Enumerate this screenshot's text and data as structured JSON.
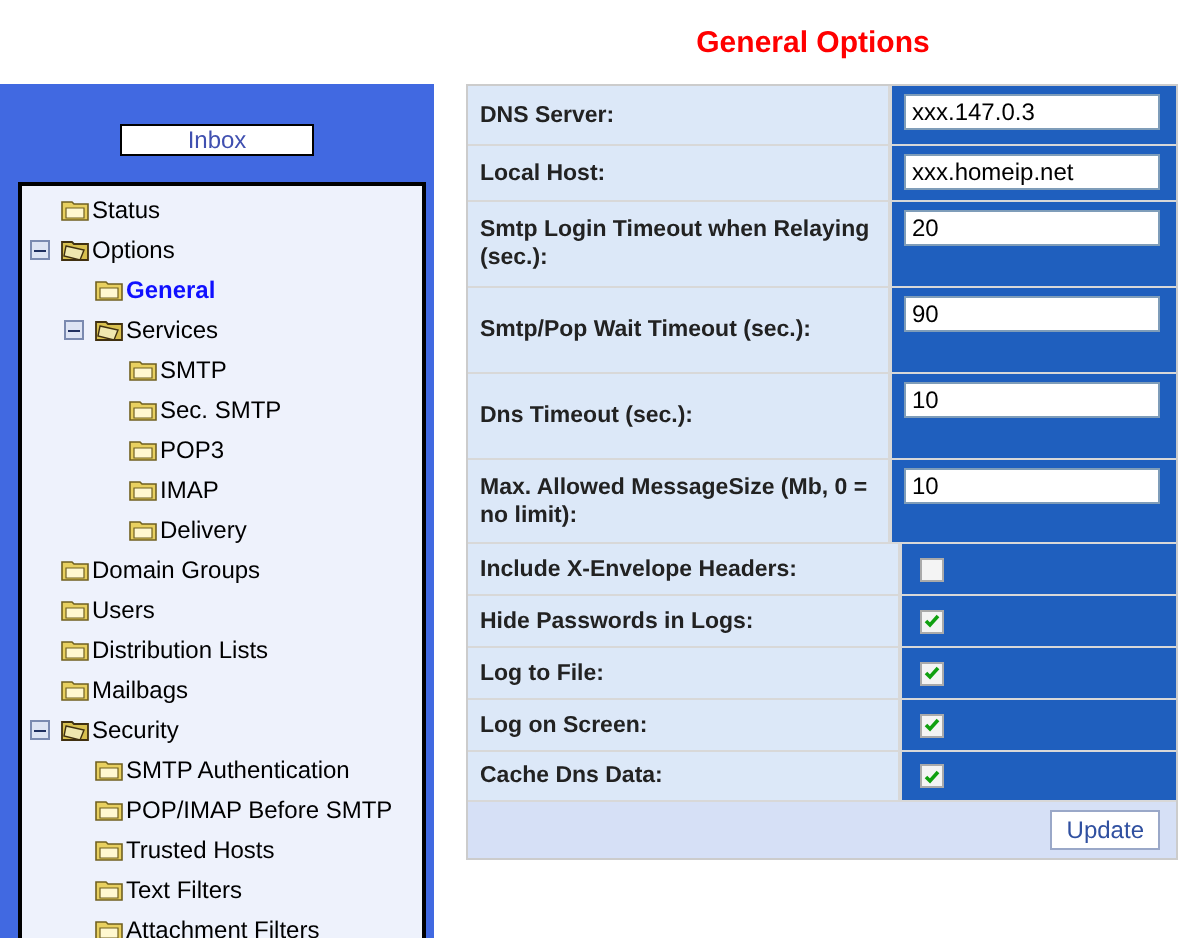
{
  "title": "General Options",
  "sidebar": {
    "inbox_button": "Inbox",
    "tree": [
      {
        "label": "Status",
        "selected": false
      },
      {
        "label": "Options",
        "selected": false,
        "expanded": true,
        "children": [
          {
            "label": "General",
            "selected": true
          },
          {
            "label": "Services",
            "selected": false,
            "expanded": true,
            "children": [
              {
                "label": "SMTP",
                "selected": false
              },
              {
                "label": "Sec. SMTP",
                "selected": false
              },
              {
                "label": "POP3",
                "selected": false
              },
              {
                "label": "IMAP",
                "selected": false
              },
              {
                "label": "Delivery",
                "selected": false
              }
            ]
          }
        ]
      },
      {
        "label": "Domain Groups",
        "selected": false
      },
      {
        "label": "Users",
        "selected": false
      },
      {
        "label": "Distribution Lists",
        "selected": false
      },
      {
        "label": "Mailbags",
        "selected": false
      },
      {
        "label": "Security",
        "selected": false,
        "expanded": true,
        "children": [
          {
            "label": "SMTP Authentication",
            "selected": false
          },
          {
            "label": "POP/IMAP Before SMTP",
            "selected": false
          },
          {
            "label": "Trusted Hosts",
            "selected": false
          },
          {
            "label": "Text Filters",
            "selected": false
          },
          {
            "label": "Attachment Filters",
            "selected": false
          }
        ]
      }
    ]
  },
  "options": [
    {
      "kind": "text",
      "label": "DNS Server:",
      "value": "xxx.147.0.3"
    },
    {
      "kind": "text",
      "label": "Local Host:",
      "value": "xxx.homeip.net"
    },
    {
      "kind": "text",
      "label": "Smtp Login Timeout when Relaying (sec.):",
      "value": "20"
    },
    {
      "kind": "text",
      "label": "Smtp/Pop Wait Timeout (sec.):",
      "value": "90"
    },
    {
      "kind": "text",
      "label": "Dns Timeout (sec.):",
      "value": "10"
    },
    {
      "kind": "text",
      "label": "Max. Allowed MessageSize (Mb, 0 = no limit):",
      "value": "10"
    },
    {
      "kind": "checkbox",
      "label": "Include X-Envelope Headers:",
      "checked": false
    },
    {
      "kind": "checkbox",
      "label": "Hide Passwords in Logs:",
      "checked": true
    },
    {
      "kind": "checkbox",
      "label": "Log to File:",
      "checked": true
    },
    {
      "kind": "checkbox",
      "label": "Log on Screen:",
      "checked": true
    },
    {
      "kind": "checkbox",
      "label": "Cache Dns Data:",
      "checked": true
    }
  ],
  "update_button": "Update"
}
